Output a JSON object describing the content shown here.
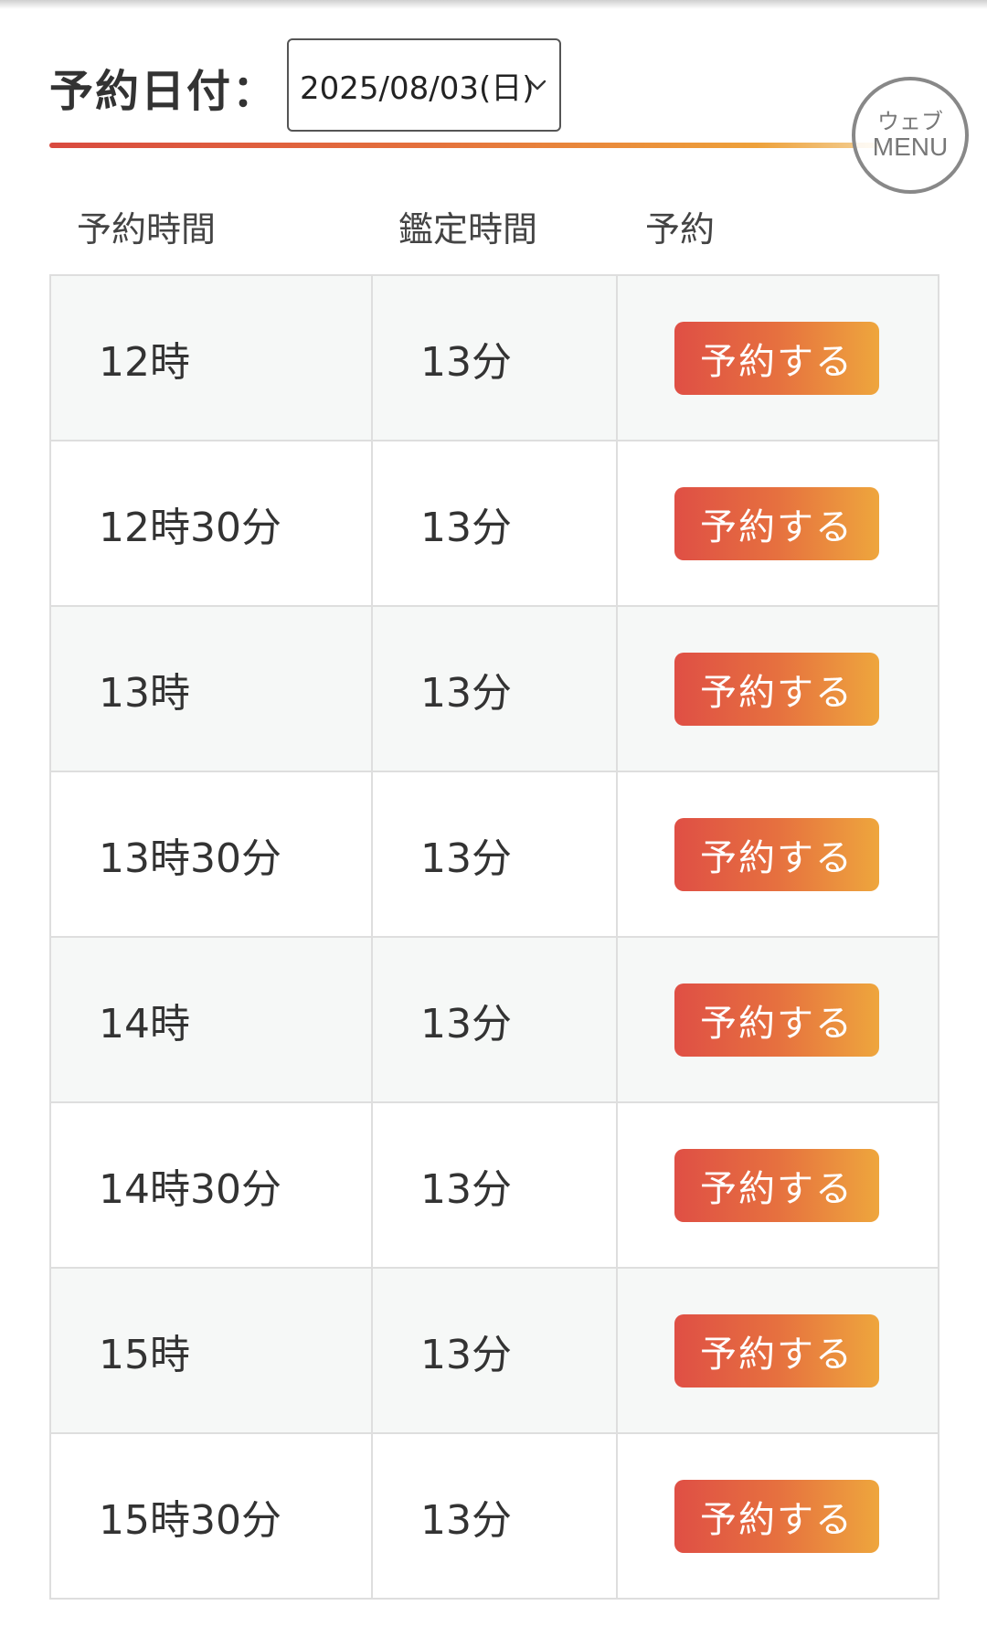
{
  "header": {
    "date_label": "予約日付：",
    "date_value": "2025/08/03(日)"
  },
  "web_menu": {
    "line1": "ウェブ",
    "line2": "MENU"
  },
  "table": {
    "columns": [
      "予約時間",
      "鑑定時間",
      "予約"
    ],
    "rows": [
      {
        "time": "12時",
        "duration": "13分",
        "button": "予約する"
      },
      {
        "time": "12時30分",
        "duration": "13分",
        "button": "予約する"
      },
      {
        "time": "13時",
        "duration": "13分",
        "button": "予約する"
      },
      {
        "time": "13時30分",
        "duration": "13分",
        "button": "予約する"
      },
      {
        "time": "14時",
        "duration": "13分",
        "button": "予約する"
      },
      {
        "time": "14時30分",
        "duration": "13分",
        "button": "予約する"
      },
      {
        "time": "15時",
        "duration": "13分",
        "button": "予約する"
      },
      {
        "time": "15時30分",
        "duration": "13分",
        "button": "予約する"
      }
    ]
  },
  "colors": {
    "accent_start": "#d94a3f",
    "accent_end": "#eea13a",
    "button_text": "#ffffff",
    "row_alt_bg": "#f6f8f7"
  },
  "icons": {
    "select_arrow": "chevron-down-icon"
  }
}
